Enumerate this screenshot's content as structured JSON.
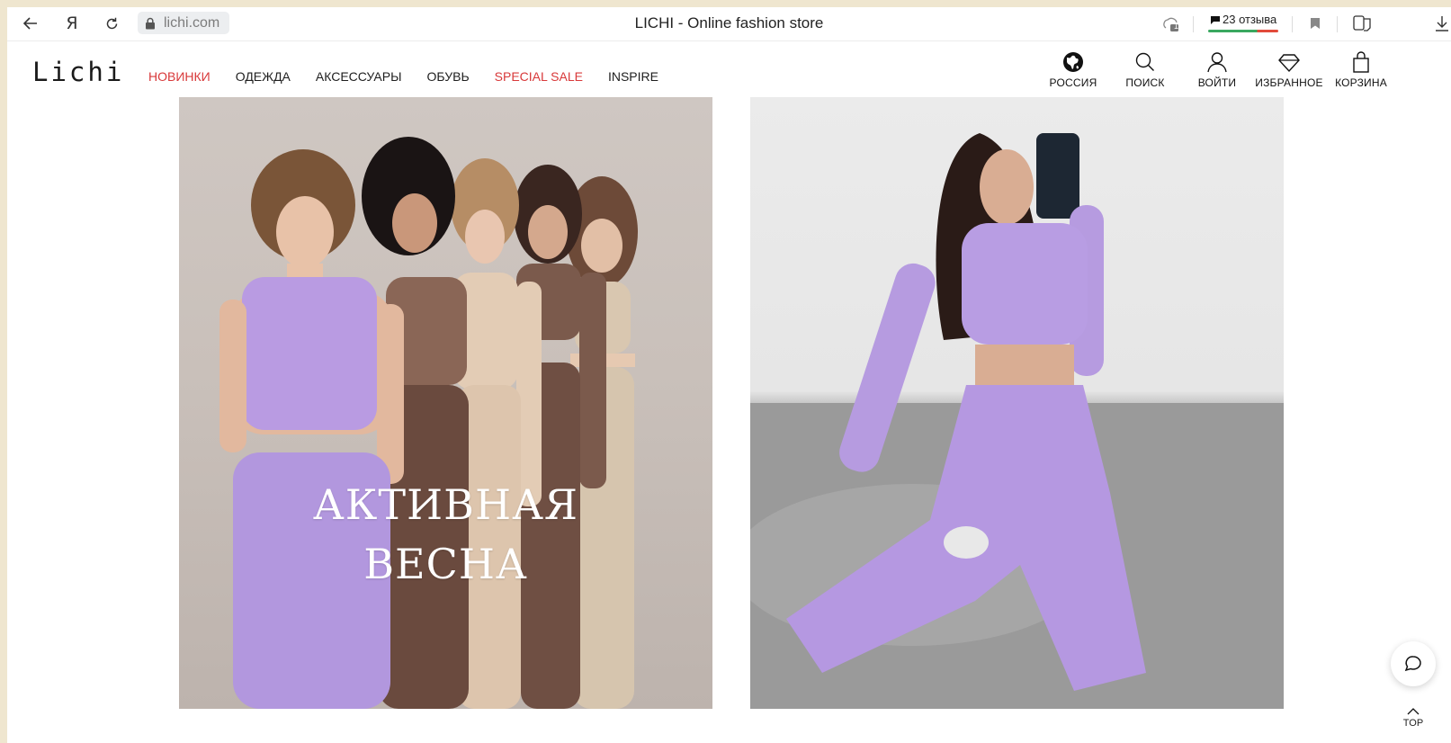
{
  "browser": {
    "url": "lichi.com",
    "tab_title": "LICHI - Online fashion store",
    "reviews_label": "23 отзыва",
    "badge_count": "1"
  },
  "header": {
    "logo": "Lichi",
    "nav": [
      {
        "label": "НОВИНКИ",
        "accent": true
      },
      {
        "label": "ОДЕЖДА",
        "accent": false
      },
      {
        "label": "АКСЕССУАРЫ",
        "accent": false
      },
      {
        "label": "ОБУВЬ",
        "accent": false
      },
      {
        "label": "SPECIAL SALE",
        "accent": true
      },
      {
        "label": "INSPIRE",
        "accent": false
      }
    ],
    "actions": {
      "region": "РОССИЯ",
      "search": "ПОИСК",
      "login": "ВОЙТИ",
      "favorites": "ИЗБРАННОЕ",
      "cart": "КОРЗИНА"
    }
  },
  "hero": {
    "title_line1": "АКТИВНАЯ",
    "title_line2": "ВЕСНА"
  },
  "floating": {
    "top_label": "TOP"
  },
  "colors": {
    "accent_red": "#d8393a",
    "lavender": "#b49ae0",
    "brown": "#7e5f50",
    "beige": "#d9c6b2"
  }
}
